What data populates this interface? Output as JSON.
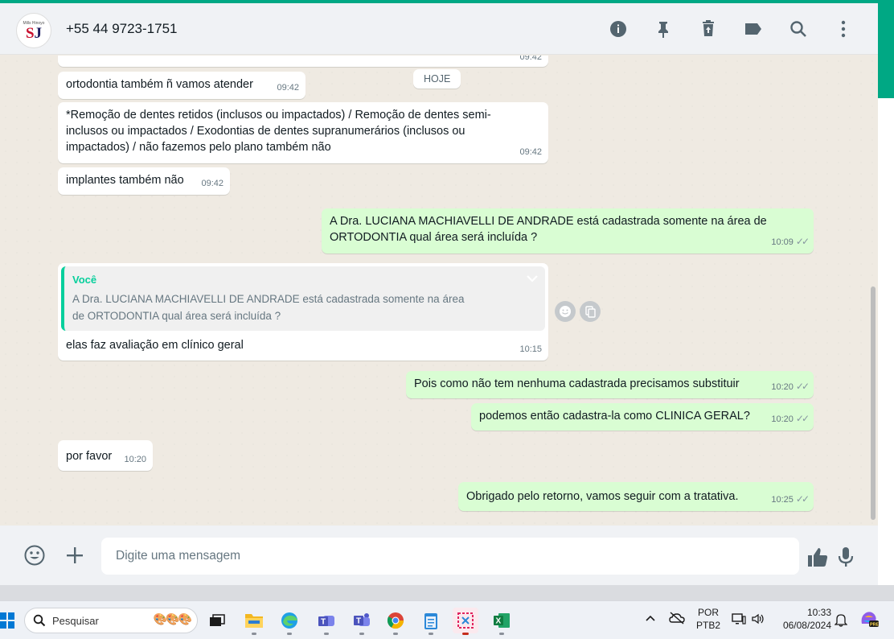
{
  "header": {
    "avatar_tiny": "Mills Hinoyo",
    "avatar_logo_s": "S",
    "avatar_logo_j": "J",
    "contact_name": "+55 44 9723-1751",
    "icons": [
      "info-icon",
      "pin-icon",
      "delete-icon",
      "label-icon",
      "search-icon",
      "menu-icon"
    ]
  },
  "chat": {
    "date_chip": "HOJE",
    "messages": [
      {
        "dir": "in",
        "text": "",
        "time": "09:42"
      },
      {
        "dir": "in",
        "text": "ortodontia também ñ vamos atender",
        "time": "09:42"
      },
      {
        "dir": "in",
        "lines": [
          "*Remoção de dentes retidos (inclusos ou impactados) /  Remoção de dentes semi-",
          "inclusos ou  impactados /  Exodontias de dentes supranumerários (inclusos ou",
          "impactados) / não fazemos pelo plano também não"
        ],
        "time": "09:42"
      },
      {
        "dir": "in",
        "text": "implantes também não",
        "time": "09:42"
      },
      {
        "dir": "out",
        "lines": [
          "A Dra. LUCIANA MACHIAVELLI DE ANDRADE está cadastrada somente na área de",
          "ORTODONTIA qual área será incluída ?"
        ],
        "time": "10:09"
      },
      {
        "dir": "in",
        "quote_author": "Você",
        "quote_lines": [
          "A Dra. LUCIANA MACHIAVELLI DE ANDRADE está cadastrada somente na área",
          "de ORTODONTIA qual área será incluída ?"
        ],
        "text": "elas faz avaliação em clínico geral",
        "time": "10:15"
      },
      {
        "dir": "out",
        "text": "Pois como não tem nenhuma cadastrada precisamos substituir",
        "time": "10:20"
      },
      {
        "dir": "out",
        "text": "podemos então cadastra-la como CLINICA GERAL?",
        "time": "10:20"
      },
      {
        "dir": "in",
        "text": "por favor",
        "time": "10:20"
      },
      {
        "dir": "out",
        "text": "Obrigado pelo retorno, vamos seguir com a tratativa.",
        "time": "10:25"
      }
    ]
  },
  "composer": {
    "placeholder": "Digite uma mensagem"
  },
  "taskbar": {
    "search_label": "Pesquisar",
    "lang_top": "POR",
    "lang_bottom": "PTB2",
    "clock_time": "10:33",
    "clock_date": "06/08/2024"
  },
  "colors": {
    "accent": "#00a884",
    "incoming": "#ffffff",
    "outgoing": "#d9fdd3",
    "chat_bg": "#efeae2",
    "quote_author": "#06cf9c"
  }
}
